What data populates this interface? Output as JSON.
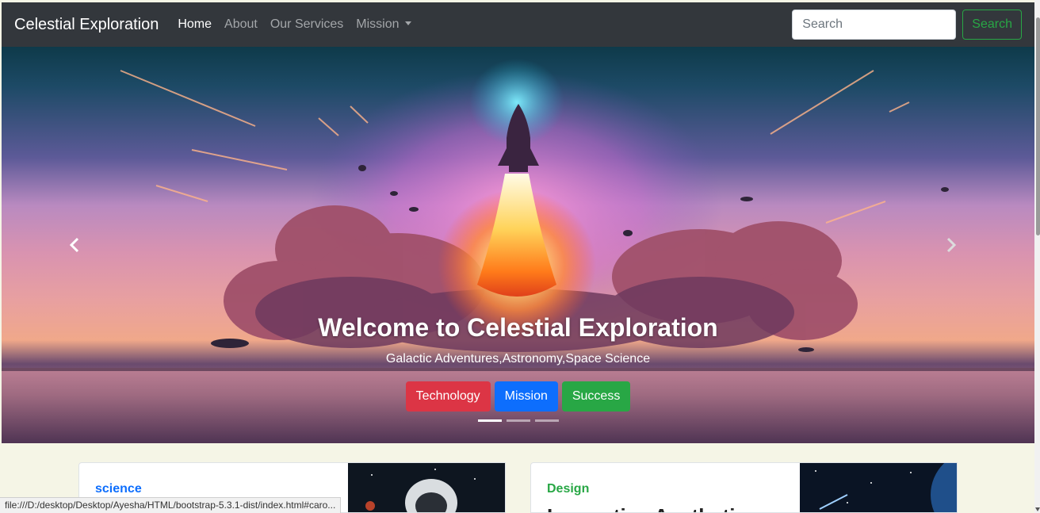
{
  "navbar": {
    "brand": "Celestial Exploration",
    "links": [
      {
        "label": "Home",
        "active": true
      },
      {
        "label": "About"
      },
      {
        "label": "Our Services"
      },
      {
        "label": "Mission"
      }
    ],
    "search_placeholder": "Search",
    "search_button": "Search"
  },
  "hero": {
    "title": "Welcome to Celestial Exploration",
    "subtitle": "Galactic Adventures,Astronomy,Space Science",
    "buttons": [
      {
        "label": "Technology",
        "color": "#dc3545"
      },
      {
        "label": "Mission",
        "color": "#0d6efd"
      },
      {
        "label": "Success",
        "color": "#28a745"
      }
    ],
    "indicator_active": 1,
    "indicator_count": 3
  },
  "cards": [
    {
      "tag": "science",
      "tag_color": "#0d6efd",
      "heading": ""
    },
    {
      "tag": "Design",
      "tag_color": "#28a745",
      "heading": "Innovative Aesthetics"
    }
  ],
  "status_url": "file:///D:/desktop/Desktop/Ayesha/HTML/bootstrap-5.3.1-dist/index.html#caro...",
  "colors": {
    "navbar": "#33373c",
    "page_bg": "#f5f5e6",
    "outline_success": "#28a745"
  }
}
